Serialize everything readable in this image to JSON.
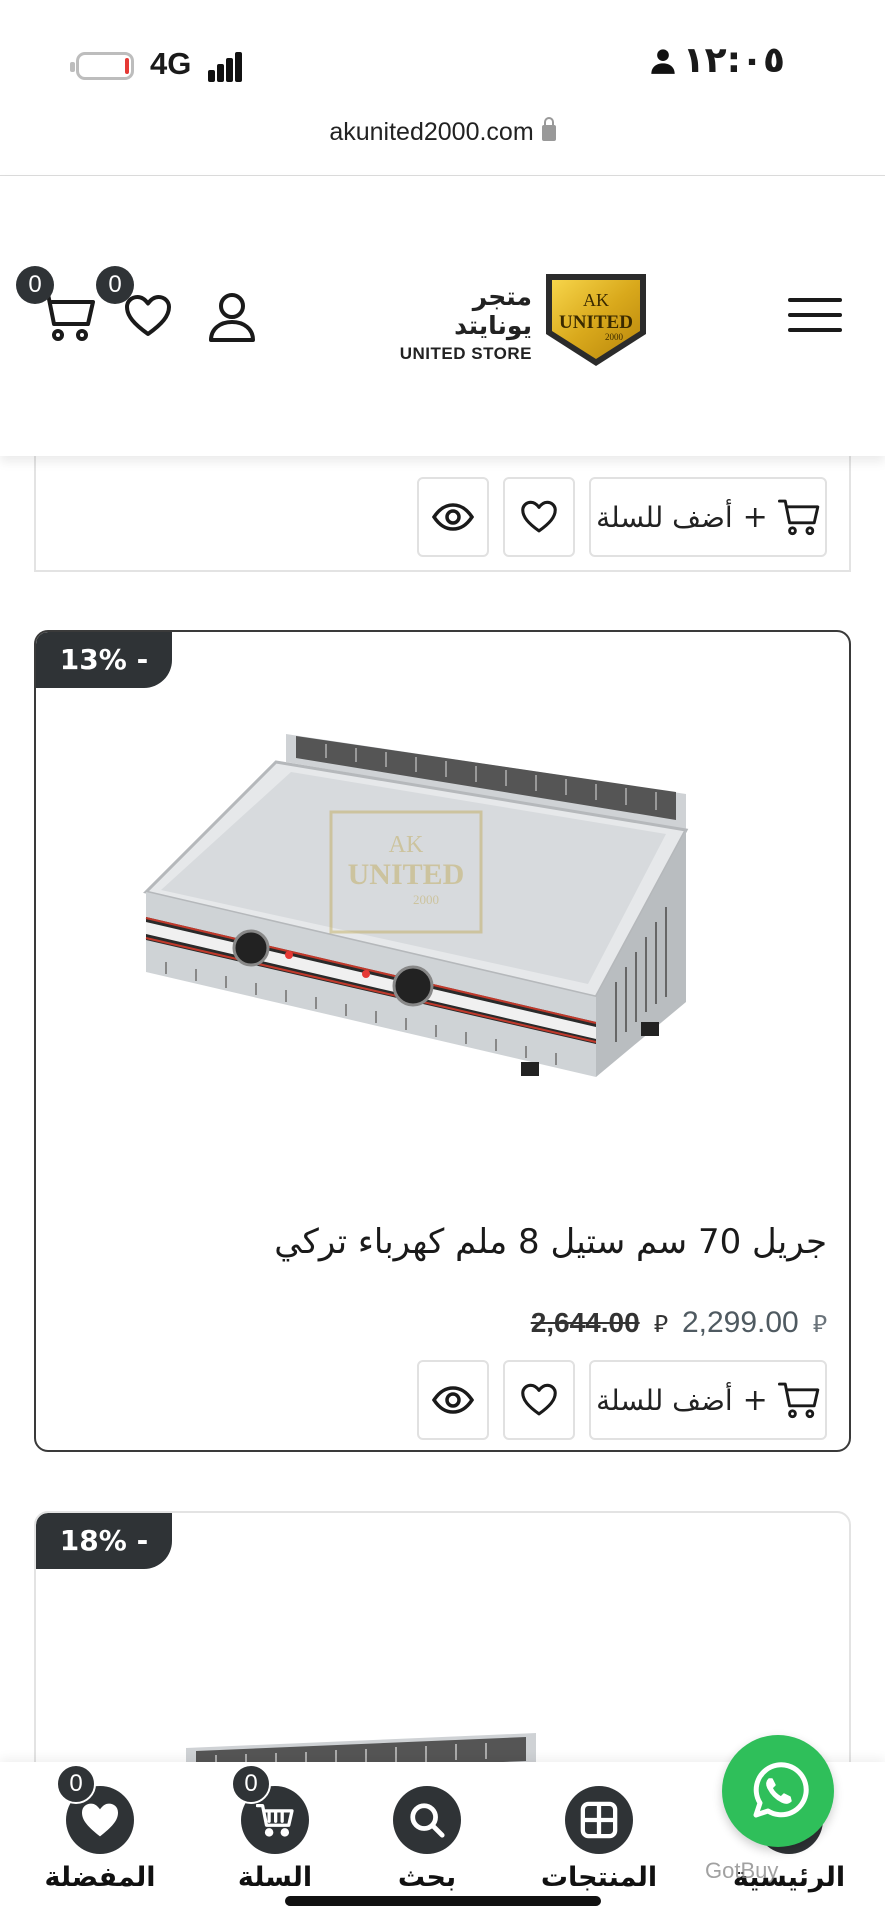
{
  "status_bar": {
    "network": "4G",
    "time": "١٢:٠٥",
    "url": "akunited2000.com"
  },
  "header": {
    "cart_count": "0",
    "wishlist_count": "0",
    "logo_arabic": "متجر يونايتد",
    "logo_english": "UNITED STORE",
    "logo_badge_top": "AK",
    "logo_badge_main": "UNITED",
    "logo_badge_sub": "2000"
  },
  "previous_product": {
    "add_to_cart_label": "أضف للسلة"
  },
  "product": {
    "discount": "- 13%",
    "title": "جريل 70 سم ستيل 8 ملم كهرباء تركي",
    "price_new": "2,299.00",
    "price_old": "2,644.00",
    "currency_symbol": "⃁",
    "add_to_cart_label": "أضف للسلة",
    "image_watermark_top": "AK",
    "image_watermark_main": "UNITED",
    "image_watermark_sub": "2000"
  },
  "next_product": {
    "discount": "- 18%"
  },
  "bottom_nav": {
    "items": [
      {
        "label": "المفضلة",
        "icon": "heart-icon",
        "badge": "0"
      },
      {
        "label": "السلة",
        "icon": "cart-icon",
        "badge": "0"
      },
      {
        "label": "بحث",
        "icon": "search-icon"
      },
      {
        "label": "المنتجات",
        "icon": "grid-icon"
      },
      {
        "label": "الرئيسية",
        "icon": "home-icon"
      }
    ]
  },
  "watermark": "GotBuy",
  "colors": {
    "dark": "#2f3336",
    "whatsapp": "#2fbf5a",
    "price": "#4f5a61"
  }
}
